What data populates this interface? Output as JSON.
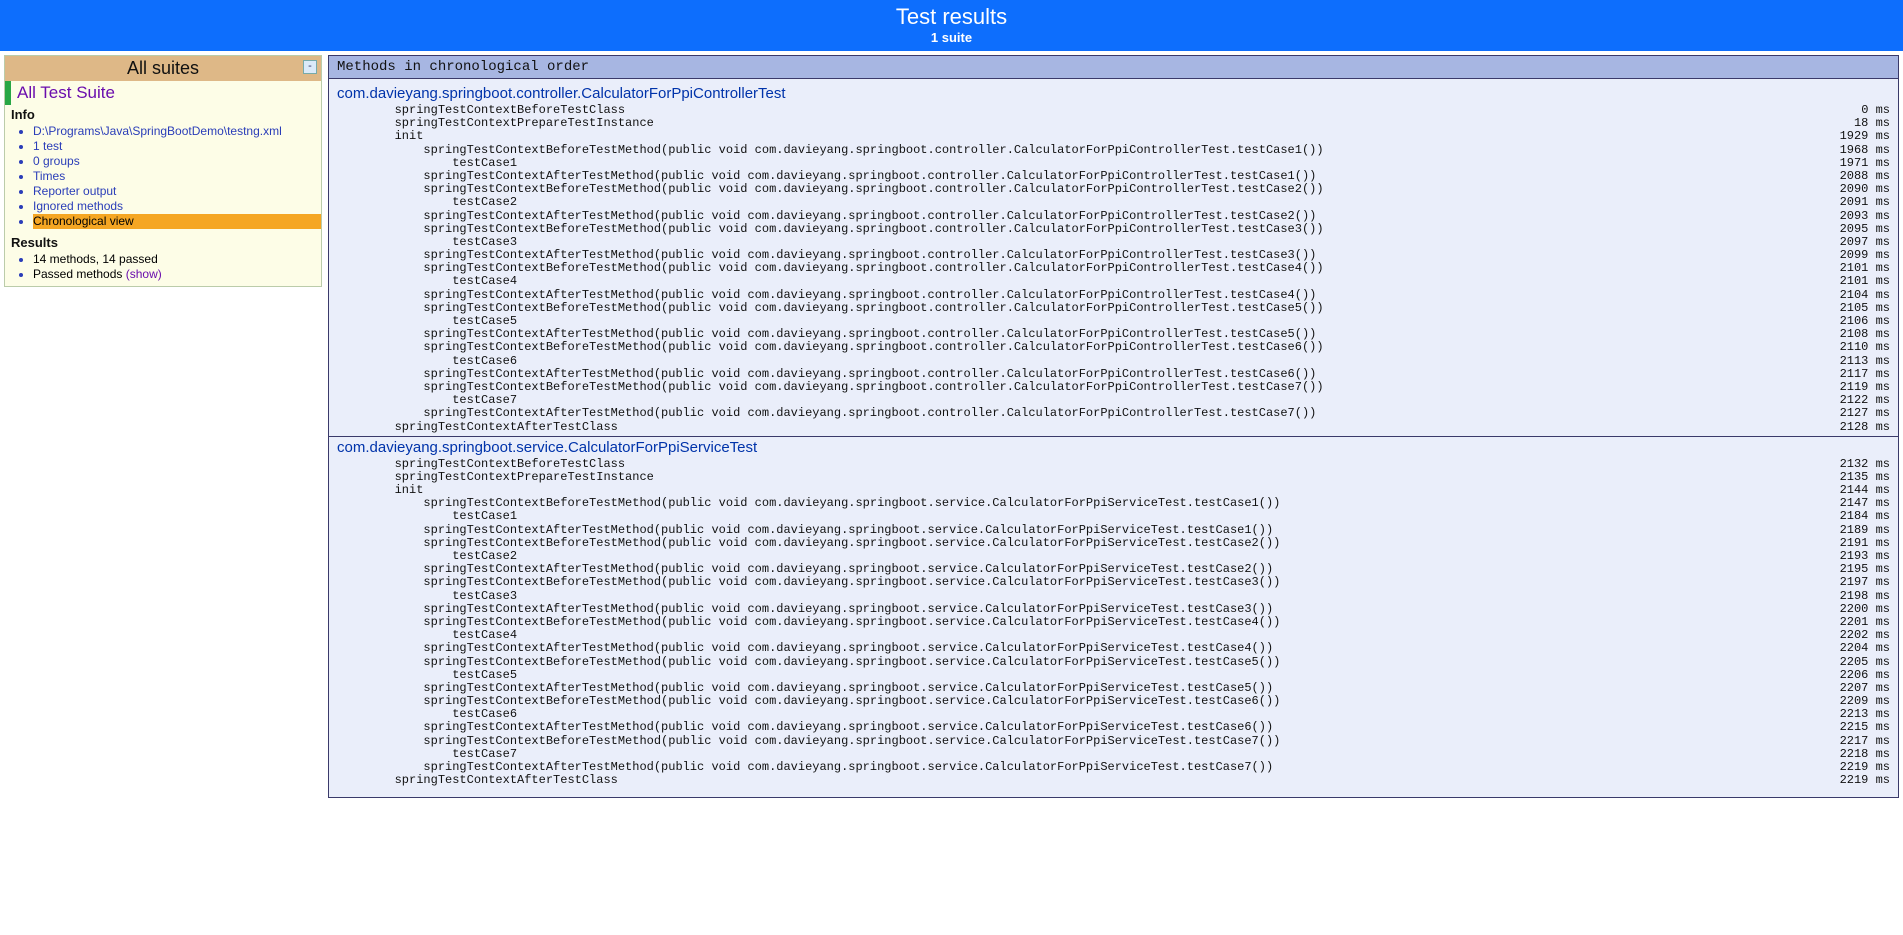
{
  "header": {
    "title": "Test results",
    "subtitle": "1 suite"
  },
  "sidebar": {
    "all_suites": "All suites",
    "minus": "-",
    "suite_name": "All Test Suite",
    "info_head": "Info",
    "info_items": [
      {
        "label": "D:\\Programs\\Java\\SpringBootDemo\\testng.xml",
        "selected": false
      },
      {
        "label": "1 test",
        "selected": false
      },
      {
        "label": "0 groups",
        "selected": false
      },
      {
        "label": "Times",
        "selected": false
      },
      {
        "label": "Reporter output",
        "selected": false
      },
      {
        "label": "Ignored methods",
        "selected": false
      },
      {
        "label": "Chronological view",
        "selected": true
      }
    ],
    "results_head": "Results",
    "results_items": [
      {
        "label": "14 methods, 14 passed",
        "show": false
      },
      {
        "label": "Passed methods",
        "show": true,
        "show_label": "(show)"
      }
    ]
  },
  "content": {
    "header": "Methods in chronological order",
    "classes": [
      {
        "name": "com.davieyang.springboot.controller.CalculatorForPpiControllerTest",
        "rows": [
          {
            "indent": 1,
            "text": "springTestContextBeforeTestClass",
            "time": "0 ms"
          },
          {
            "indent": 1,
            "text": "springTestContextPrepareTestInstance",
            "time": "18 ms"
          },
          {
            "indent": 1,
            "text": "init",
            "time": "1929 ms"
          },
          {
            "indent": 2,
            "text": "springTestContextBeforeTestMethod(public void com.davieyang.springboot.controller.CalculatorForPpiControllerTest.testCase1())",
            "time": "1968 ms"
          },
          {
            "indent": 3,
            "text": "testCase1",
            "time": "1971 ms"
          },
          {
            "indent": 2,
            "text": "springTestContextAfterTestMethod(public void com.davieyang.springboot.controller.CalculatorForPpiControllerTest.testCase1())",
            "time": "2088 ms"
          },
          {
            "indent": 2,
            "text": "springTestContextBeforeTestMethod(public void com.davieyang.springboot.controller.CalculatorForPpiControllerTest.testCase2())",
            "time": "2090 ms"
          },
          {
            "indent": 3,
            "text": "testCase2",
            "time": "2091 ms"
          },
          {
            "indent": 2,
            "text": "springTestContextAfterTestMethod(public void com.davieyang.springboot.controller.CalculatorForPpiControllerTest.testCase2())",
            "time": "2093 ms"
          },
          {
            "indent": 2,
            "text": "springTestContextBeforeTestMethod(public void com.davieyang.springboot.controller.CalculatorForPpiControllerTest.testCase3())",
            "time": "2095 ms"
          },
          {
            "indent": 3,
            "text": "testCase3",
            "time": "2097 ms"
          },
          {
            "indent": 2,
            "text": "springTestContextAfterTestMethod(public void com.davieyang.springboot.controller.CalculatorForPpiControllerTest.testCase3())",
            "time": "2099 ms"
          },
          {
            "indent": 2,
            "text": "springTestContextBeforeTestMethod(public void com.davieyang.springboot.controller.CalculatorForPpiControllerTest.testCase4())",
            "time": "2101 ms"
          },
          {
            "indent": 3,
            "text": "testCase4",
            "time": "2101 ms"
          },
          {
            "indent": 2,
            "text": "springTestContextAfterTestMethod(public void com.davieyang.springboot.controller.CalculatorForPpiControllerTest.testCase4())",
            "time": "2104 ms"
          },
          {
            "indent": 2,
            "text": "springTestContextBeforeTestMethod(public void com.davieyang.springboot.controller.CalculatorForPpiControllerTest.testCase5())",
            "time": "2105 ms"
          },
          {
            "indent": 3,
            "text": "testCase5",
            "time": "2106 ms"
          },
          {
            "indent": 2,
            "text": "springTestContextAfterTestMethod(public void com.davieyang.springboot.controller.CalculatorForPpiControllerTest.testCase5())",
            "time": "2108 ms"
          },
          {
            "indent": 2,
            "text": "springTestContextBeforeTestMethod(public void com.davieyang.springboot.controller.CalculatorForPpiControllerTest.testCase6())",
            "time": "2110 ms"
          },
          {
            "indent": 3,
            "text": "testCase6",
            "time": "2113 ms"
          },
          {
            "indent": 2,
            "text": "springTestContextAfterTestMethod(public void com.davieyang.springboot.controller.CalculatorForPpiControllerTest.testCase6())",
            "time": "2117 ms"
          },
          {
            "indent": 2,
            "text": "springTestContextBeforeTestMethod(public void com.davieyang.springboot.controller.CalculatorForPpiControllerTest.testCase7())",
            "time": "2119 ms"
          },
          {
            "indent": 3,
            "text": "testCase7",
            "time": "2122 ms"
          },
          {
            "indent": 2,
            "text": "springTestContextAfterTestMethod(public void com.davieyang.springboot.controller.CalculatorForPpiControllerTest.testCase7())",
            "time": "2127 ms"
          },
          {
            "indent": 1,
            "text": "springTestContextAfterTestClass",
            "time": "2128 ms"
          }
        ]
      },
      {
        "name": "com.davieyang.springboot.service.CalculatorForPpiServiceTest",
        "rows": [
          {
            "indent": 1,
            "text": "springTestContextBeforeTestClass",
            "time": "2132 ms"
          },
          {
            "indent": 1,
            "text": "springTestContextPrepareTestInstance",
            "time": "2135 ms"
          },
          {
            "indent": 1,
            "text": "init",
            "time": "2144 ms"
          },
          {
            "indent": 2,
            "text": "springTestContextBeforeTestMethod(public void com.davieyang.springboot.service.CalculatorForPpiServiceTest.testCase1())",
            "time": "2147 ms"
          },
          {
            "indent": 3,
            "text": "testCase1",
            "time": "2184 ms"
          },
          {
            "indent": 2,
            "text": "springTestContextAfterTestMethod(public void com.davieyang.springboot.service.CalculatorForPpiServiceTest.testCase1())",
            "time": "2189 ms"
          },
          {
            "indent": 2,
            "text": "springTestContextBeforeTestMethod(public void com.davieyang.springboot.service.CalculatorForPpiServiceTest.testCase2())",
            "time": "2191 ms"
          },
          {
            "indent": 3,
            "text": "testCase2",
            "time": "2193 ms"
          },
          {
            "indent": 2,
            "text": "springTestContextAfterTestMethod(public void com.davieyang.springboot.service.CalculatorForPpiServiceTest.testCase2())",
            "time": "2195 ms"
          },
          {
            "indent": 2,
            "text": "springTestContextBeforeTestMethod(public void com.davieyang.springboot.service.CalculatorForPpiServiceTest.testCase3())",
            "time": "2197 ms"
          },
          {
            "indent": 3,
            "text": "testCase3",
            "time": "2198 ms"
          },
          {
            "indent": 2,
            "text": "springTestContextAfterTestMethod(public void com.davieyang.springboot.service.CalculatorForPpiServiceTest.testCase3())",
            "time": "2200 ms"
          },
          {
            "indent": 2,
            "text": "springTestContextBeforeTestMethod(public void com.davieyang.springboot.service.CalculatorForPpiServiceTest.testCase4())",
            "time": "2201 ms"
          },
          {
            "indent": 3,
            "text": "testCase4",
            "time": "2202 ms"
          },
          {
            "indent": 2,
            "text": "springTestContextAfterTestMethod(public void com.davieyang.springboot.service.CalculatorForPpiServiceTest.testCase4())",
            "time": "2204 ms"
          },
          {
            "indent": 2,
            "text": "springTestContextBeforeTestMethod(public void com.davieyang.springboot.service.CalculatorForPpiServiceTest.testCase5())",
            "time": "2205 ms"
          },
          {
            "indent": 3,
            "text": "testCase5",
            "time": "2206 ms"
          },
          {
            "indent": 2,
            "text": "springTestContextAfterTestMethod(public void com.davieyang.springboot.service.CalculatorForPpiServiceTest.testCase5())",
            "time": "2207 ms"
          },
          {
            "indent": 2,
            "text": "springTestContextBeforeTestMethod(public void com.davieyang.springboot.service.CalculatorForPpiServiceTest.testCase6())",
            "time": "2209 ms"
          },
          {
            "indent": 3,
            "text": "testCase6",
            "time": "2213 ms"
          },
          {
            "indent": 2,
            "text": "springTestContextAfterTestMethod(public void com.davieyang.springboot.service.CalculatorForPpiServiceTest.testCase6())",
            "time": "2215 ms"
          },
          {
            "indent": 2,
            "text": "springTestContextBeforeTestMethod(public void com.davieyang.springboot.service.CalculatorForPpiServiceTest.testCase7())",
            "time": "2217 ms"
          },
          {
            "indent": 3,
            "text": "testCase7",
            "time": "2218 ms"
          },
          {
            "indent": 2,
            "text": "springTestContextAfterTestMethod(public void com.davieyang.springboot.service.CalculatorForPpiServiceTest.testCase7())",
            "time": "2219 ms"
          },
          {
            "indent": 1,
            "text": "springTestContextAfterTestClass",
            "time": "2219 ms"
          }
        ]
      }
    ]
  }
}
